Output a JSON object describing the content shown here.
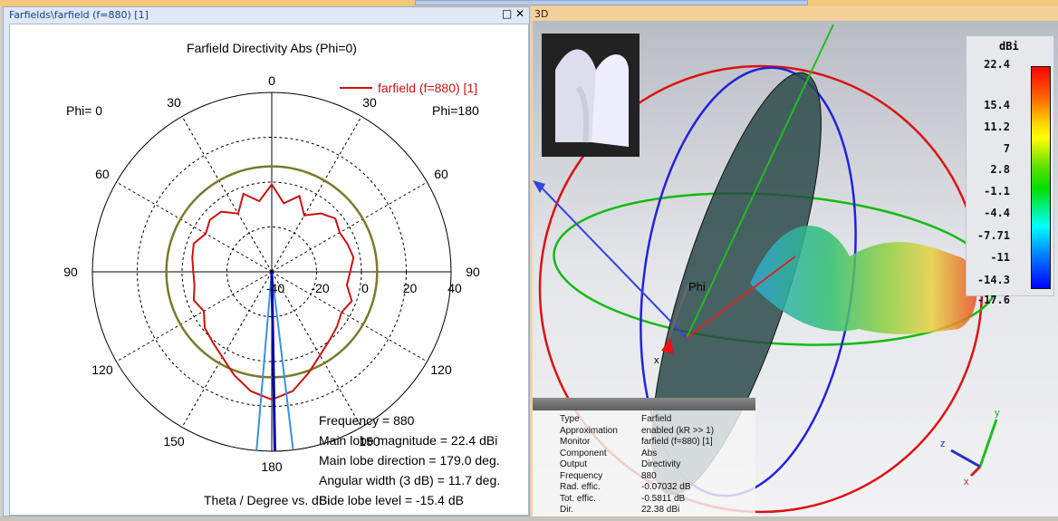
{
  "left_window": {
    "title": "Farfields\\farfield (f=880) [1]",
    "maximize_icon": "maximize-icon",
    "close_icon": "close-icon"
  },
  "right_window": {
    "title": "3D"
  },
  "chart_data": {
    "type": "polar-line",
    "title": "Farfield Directivity Abs (Phi=0)",
    "legend": "farfield (f=880) [1]",
    "legend_placement": "top-right",
    "left_label": "Phi=  0",
    "right_label": "Phi=180",
    "xlabel": "Theta / Degree vs. dBi",
    "radial_ticks": [
      "-40",
      "-20",
      "0",
      "20",
      "40"
    ],
    "radial_range": [
      -40,
      40
    ],
    "angle_ticks": {
      "top": "0",
      "left": [
        "30",
        "60",
        "90",
        "120",
        "150"
      ],
      "right": [
        "30",
        "60",
        "90",
        "120",
        "150"
      ],
      "bottom": "180"
    },
    "grid": true,
    "theta": [
      0,
      10,
      20,
      30,
      40,
      50,
      60,
      70,
      80,
      90,
      100,
      110,
      120,
      130,
      140,
      150,
      160,
      170,
      180
    ],
    "series": [
      {
        "name": "farfield (f=880) [1]",
        "half": "Phi=180",
        "values": [
          -1,
          -9,
          -4,
          -11,
          -6,
          -3,
          -5,
          -4,
          -3,
          -5,
          -6,
          -2,
          -4,
          -2,
          0,
          3,
          8,
          14,
          17
        ]
      },
      {
        "name": "farfield (f=880) [1]",
        "half": "Phi=0",
        "values": [
          -1,
          -8,
          -3,
          -10,
          -5,
          -4,
          -6,
          -3,
          -4,
          -5,
          -5,
          -3,
          -5,
          -1,
          1,
          4,
          9,
          14,
          17
        ]
      }
    ],
    "side_lobe_circle_db": 7,
    "main_lobe_direction": 179.0,
    "beamwidth_lines": [
      173.15,
      184.85
    ],
    "colors": {
      "pattern": "#cc1111",
      "sidelobe": "#7a7a2a",
      "mainlobe": "#0000aa",
      "beamwidth": "#3a90e0"
    },
    "annotations": [
      "Frequency = 880",
      "Main lobe magnitude =      22.4 dBi",
      "Main lobe direction =  179.0 deg.",
      "Angular width (3 dB) =   11.7 deg.",
      "Side lobe level =  -15.4 dB"
    ]
  },
  "view3d": {
    "axis_label_phi": "Phi",
    "axis_x": "x",
    "axis_y": "y",
    "axis_z": "z",
    "colorbar": {
      "unit": "dBi",
      "ticks": [
        "22.4",
        "15.4",
        "11.2",
        "7",
        "2.8",
        "-1.1",
        "-4.4",
        "-7.71",
        "-11",
        "-14.3",
        "-17.6"
      ]
    },
    "info": [
      [
        "Type",
        "Farfield"
      ],
      [
        "Approximation",
        "enabled (kR >> 1)"
      ],
      [
        "Monitor",
        "farfield (f=880) [1]"
      ],
      [
        "Component",
        "Abs"
      ],
      [
        "Output",
        "Directivity"
      ],
      [
        "Frequency",
        "880"
      ],
      [
        "Rad. effic.",
        "-0.07032 dB"
      ],
      [
        "Tot. effic.",
        "-0.5811 dB"
      ],
      [
        "Dir.",
        "22.38 dBi"
      ]
    ]
  }
}
